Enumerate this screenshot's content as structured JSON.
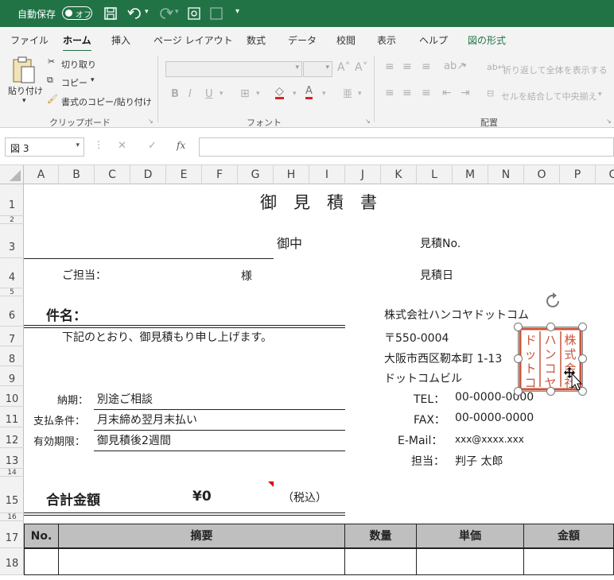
{
  "titlebar": {
    "autosave_label": "自動保存",
    "autosave_state": "オフ"
  },
  "menu": [
    "ファイル",
    "ホーム",
    "挿入",
    "ページ レイアウト",
    "数式",
    "データ",
    "校閲",
    "表示",
    "ヘルプ",
    "図の形式"
  ],
  "ribbon": {
    "paste": "貼り付け",
    "cut": "切り取り",
    "copy": "コピー",
    "format_painter": "書式のコピー/貼り付け",
    "clipboard_group": "クリップボード",
    "bold": "B",
    "italic": "I",
    "underline": "U",
    "font_group": "フォント",
    "wrap_text": "折り返して全体を表示する",
    "merge_center": "セルを結合して中央揃え",
    "alignment_group": "配置"
  },
  "formula_bar": {
    "name_box": "図 3",
    "cancel": "✕",
    "enter": "✓",
    "fx": "fx",
    "value": ""
  },
  "columns": [
    "A",
    "B",
    "C",
    "D",
    "E",
    "F",
    "G",
    "H",
    "I",
    "J",
    "K",
    "L",
    "M",
    "N",
    "O",
    "P",
    "Q"
  ],
  "rows": [
    "1",
    "2",
    "3",
    "4",
    "5",
    "6",
    "7",
    "8",
    "9",
    "10",
    "11",
    "12",
    "13",
    "14",
    "15",
    "16",
    "17",
    "18"
  ],
  "sheet": {
    "title": "御　見　積　書",
    "onchu": "御中",
    "quote_no": "見積No.",
    "quote_date": "見積日",
    "contact": "ご担当：",
    "sama": "様",
    "subject": "件名：",
    "intro": "下記のとおり、御見積もり申し上げます。",
    "delivery_label": "納期：",
    "delivery_value": "別途ご相談",
    "payment_label": "支払条件：",
    "payment_value": "月末締め翌月末払い",
    "valid_label": "有効期限：",
    "valid_value": "御見積後2週間",
    "total_label": "合計金額",
    "total_value": "¥0",
    "tax": "（税込）",
    "company": "株式会社ハンコヤドットコム",
    "postal": "〒550-0004",
    "address": "大阪市西区靭本町 1-13",
    "building": "ドットコムビル",
    "tel_label": "TEL：",
    "tel": "00-0000-0000",
    "fax_label": "FAX：",
    "fax": "00-0000-0000",
    "email_label": "E-Mail：",
    "email": "xxx@xxxx.xxx",
    "rep_label": "担当：",
    "rep": "判子 太郎",
    "table_headers": [
      "No.",
      "摘要",
      "数量",
      "単価",
      "金額"
    ]
  },
  "seal": {
    "color": "#c8553a",
    "text": "株式会社ハンコヤドットコム"
  }
}
